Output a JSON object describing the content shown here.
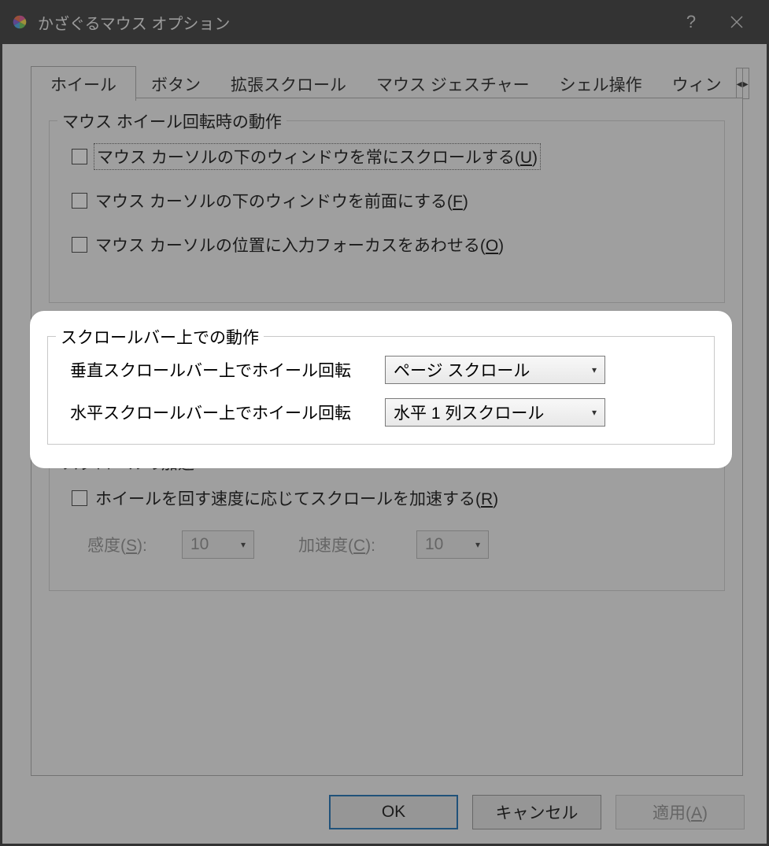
{
  "window": {
    "title": "かざぐるマウス オプション"
  },
  "tabs": {
    "items": [
      "ホイール",
      "ボタン",
      "拡張スクロール",
      "マウス ジェスチャー",
      "シェル操作",
      "ウィン"
    ],
    "active_index": 0,
    "scroll_left": "◂",
    "scroll_right": "▸"
  },
  "group1": {
    "legend": "マウス ホイール回転時の動作",
    "cb1_pre": "マウス カーソルの下のウィンドウを常にスクロールする(",
    "cb1_u": "U",
    "cb1_post": ")",
    "cb2_pre": "マウス カーソルの下のウィンドウを前面にする(",
    "cb2_u": "F",
    "cb2_post": ")",
    "cb3_pre": "マウス カーソルの位置に入力フォーカスをあわせる(",
    "cb3_u": "O",
    "cb3_post": ")"
  },
  "group2": {
    "legend": "スクロールバー上での動作",
    "row1_label": "垂直スクロールバー上でホイール回転",
    "row1_value": "ページ スクロール",
    "row2_label": "水平スクロールバー上でホイール回転",
    "row2_value": "水平 1 列スクロール"
  },
  "group3": {
    "legend": "スクロールの加速",
    "cb_pre": "ホイールを回す速度に応じてスクロールを加速する(",
    "cb_u": "R",
    "cb_post": ")",
    "sens_label_pre": "感度(",
    "sens_label_u": "S",
    "sens_label_post": "):",
    "sens_value": "10",
    "accel_label_pre": "加速度(",
    "accel_label_u": "C",
    "accel_label_post": "):",
    "accel_value": "10"
  },
  "buttons": {
    "ok": "OK",
    "cancel": "キャンセル",
    "apply_pre": "適用(",
    "apply_u": "A",
    "apply_post": ")"
  }
}
